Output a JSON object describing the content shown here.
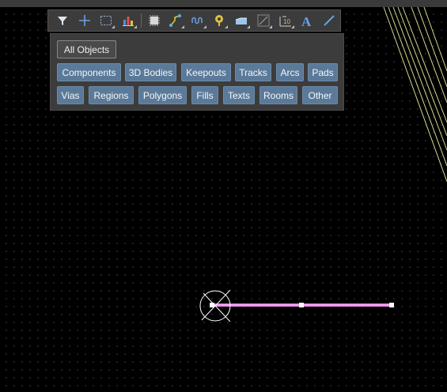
{
  "toolbar": {
    "icons": [
      "filter-icon",
      "cross-icon",
      "select-area-icon",
      "chart-icon",
      "component-icon",
      "route-icon",
      "meander-icon",
      "via-icon",
      "polygon-icon",
      "dimension-icon",
      "text-frame-icon",
      "text-icon",
      "line-icon"
    ]
  },
  "filter_panel": {
    "all_objects": "All Objects",
    "row1": [
      "Components",
      "3D Bodies",
      "Keepouts",
      "Tracks",
      "Arcs",
      "Pads"
    ],
    "row2": [
      "Vias",
      "Regions",
      "Polygons",
      "Fills",
      "Texts",
      "Rooms",
      "Other"
    ]
  },
  "colors": {
    "background": "#000000",
    "track": "#e080e0",
    "button": "#5b7a99",
    "panel": "#3c3c3c",
    "diagonal_lines": "#e8e8a0"
  }
}
